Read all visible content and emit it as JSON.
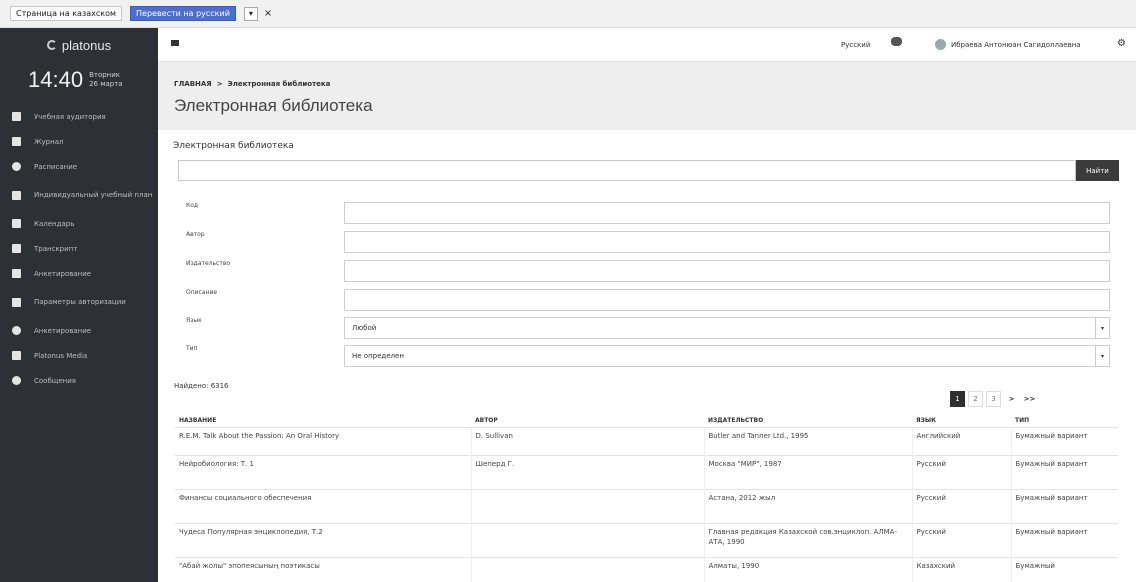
{
  "translate_bar": {
    "kazakh_page_label": "Страница на казахском",
    "translate_button": "Перевести на русский",
    "close": "×"
  },
  "sidebar": {
    "logo_text": "platonus",
    "time": "14:40",
    "day": "Вторник",
    "date": "26 марта",
    "items": [
      {
        "label": "Учебная аудитория"
      },
      {
        "label": "Журнал"
      },
      {
        "label": "Расписание"
      },
      {
        "label": "Индивидуальный учебный план"
      },
      {
        "label": "Календарь"
      },
      {
        "label": "Транскрипт"
      },
      {
        "label": "Анкетирование"
      },
      {
        "label": "Параметры авторизации"
      },
      {
        "label": "Анкетирование"
      },
      {
        "label": "Platonus Media"
      },
      {
        "label": "Сообщения"
      }
    ]
  },
  "topbar": {
    "language": "Русский",
    "user_name": "Ибраева Антонюан Сагидоллаевна"
  },
  "header": {
    "breadcrumb_home": "ГЛАВНАЯ",
    "breadcrumb_sep": ">",
    "breadcrumb_current": "Электронная библиотека",
    "title": "Электронная библиотека"
  },
  "panel": {
    "title": "Электронная библиотека",
    "search_button": "Найти",
    "fields": {
      "code": {
        "label": "Код",
        "value": ""
      },
      "author": {
        "label": "Автор",
        "value": ""
      },
      "publisher": {
        "label": "Издательство",
        "value": ""
      },
      "description": {
        "label": "Описание",
        "value": ""
      },
      "language": {
        "label": "Язык",
        "value": "Любой"
      },
      "type": {
        "label": "Тип",
        "value": "Не определен"
      }
    },
    "found_text": "Найдено: 6316",
    "pagination": [
      "1",
      "2",
      "3",
      ">",
      ">>"
    ]
  },
  "table": {
    "columns": [
      "НАЗВАНИЕ",
      "АВТОР",
      "ИЗДАТЕЛЬСТВО",
      "ЯЗЫК",
      "ТИП"
    ],
    "rows": [
      [
        "R.E.M. Talk About the Passion: An Oral History",
        "D. Sullivan",
        "Butler and Tanner Ltd., 1995",
        "Английский",
        "Бумажный вариант"
      ],
      [
        "Нейробиология: Т. 1",
        "Шеперд Г.",
        "Москва \"МИР\", 1987",
        "Русский",
        "Бумажный вариант"
      ],
      [
        "Финансы социального обеспечения",
        "",
        "Астана, 2012 жыл",
        "Русский",
        "Бумажный вариант"
      ],
      [
        "Чудеса Популярная энциклопедия, Т.2",
        "",
        "Главная редакция Казахской сов.энциклоп. АЛМА-АТА, 1990",
        "Русский",
        "Бумажный вариант"
      ],
      [
        "\"Абай жолы\" эпопеясының поэтикасы",
        "",
        "Алматы, 1990",
        "Казахский",
        "Бумажный"
      ]
    ]
  }
}
